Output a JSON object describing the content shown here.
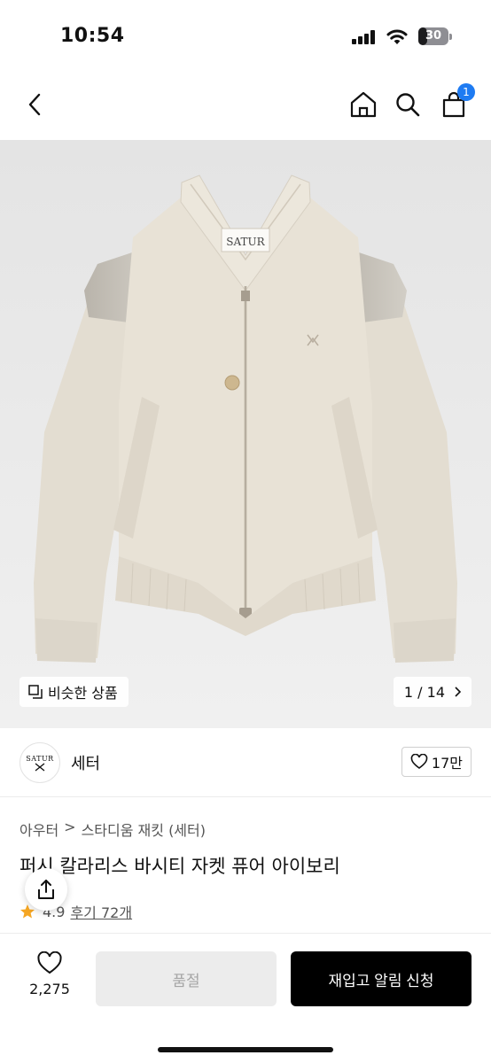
{
  "status": {
    "time": "10:54",
    "battery": "30",
    "battery_level": 0.3
  },
  "nav": {
    "cart_count": "1",
    "icons": [
      "back-icon",
      "home-icon",
      "search-icon",
      "cart-icon"
    ]
  },
  "hero": {
    "similar_label": "비슷한 상품",
    "image_counter": "1 / 14",
    "jacket_label": "SATUR"
  },
  "brand": {
    "logo_text": "SATUR",
    "name": "세터",
    "likes": "17만"
  },
  "breadcrumb": {
    "items": [
      "아우터",
      "스타디움 재킷 (세터)"
    ]
  },
  "product": {
    "title": "퍼시 칼라리스 바시티 자켓 퓨어 아이보리",
    "rating": "4.9",
    "reviews": "후기 72개"
  },
  "bottom": {
    "wish_count": "2,275",
    "soldout_label": "품절",
    "restock_label": "재입고 알림 신청"
  },
  "colors": {
    "accent": "#1e7bf2",
    "star": "#f5a623",
    "primary_button": "#000000",
    "disabled_button": "#ececec"
  }
}
